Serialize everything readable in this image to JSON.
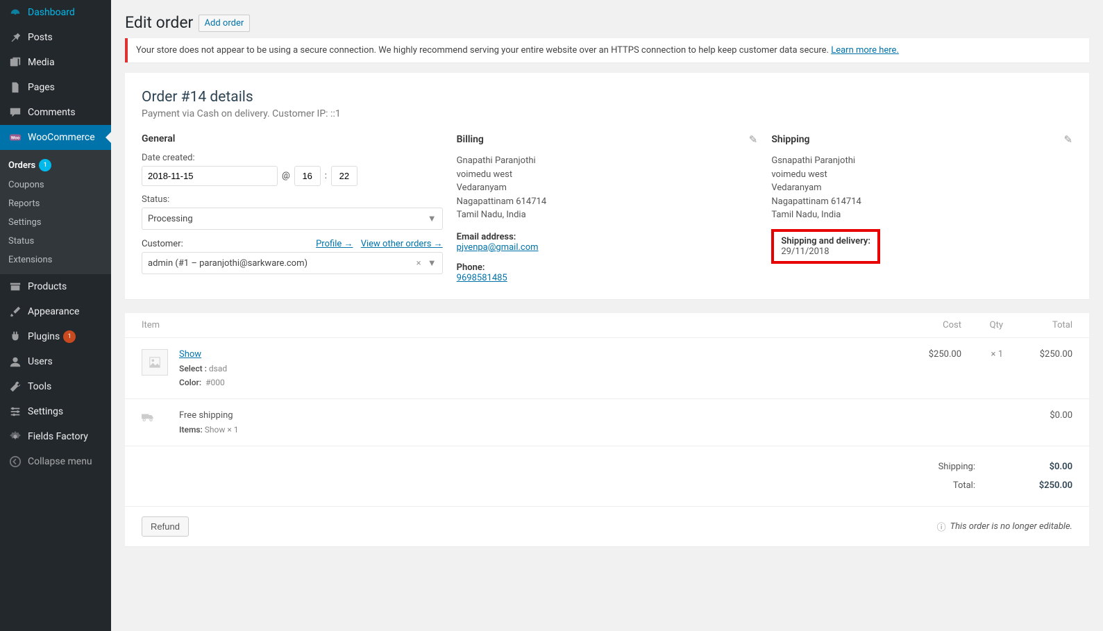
{
  "sidebar": {
    "dashboard": "Dashboard",
    "posts": "Posts",
    "media": "Media",
    "pages": "Pages",
    "comments": "Comments",
    "woocommerce": "WooCommerce",
    "submenu": {
      "orders": "Orders",
      "orders_count": "1",
      "coupons": "Coupons",
      "reports": "Reports",
      "settings": "Settings",
      "status": "Status",
      "extensions": "Extensions"
    },
    "products": "Products",
    "appearance": "Appearance",
    "plugins": "Plugins",
    "plugins_count": "1",
    "users": "Users",
    "tools": "Tools",
    "settings2": "Settings",
    "fields_factory": "Fields Factory",
    "collapse": "Collapse menu"
  },
  "header": {
    "title": "Edit order",
    "add": "Add order"
  },
  "notice": {
    "text": "Your store does not appear to be using a secure connection. We highly recommend serving your entire website over an HTTPS connection to help keep customer data secure. ",
    "link": "Learn more here."
  },
  "order": {
    "title": "Order #14 details",
    "sub": "Payment via Cash on delivery. Customer IP: ::1"
  },
  "general": {
    "heading": "General",
    "date_label": "Date created:",
    "date": "2018-11-15",
    "at": "@",
    "hour": "16",
    "sep": ":",
    "min": "22",
    "status_label": "Status:",
    "status": "Processing",
    "customer_label": "Customer:",
    "profile": "Profile →",
    "view_others": "View other orders →",
    "customer": "admin (#1 – paranjothi@sarkware.com)"
  },
  "billing": {
    "heading": "Billing",
    "name": "Gnapathi Paranjothi",
    "street": "voimedu west",
    "city": "Vedaranyam",
    "district": "Nagapattinam 614714",
    "state": "Tamil Nadu, India",
    "email_label": "Email address:",
    "email": "pjvenpa@gmail.com",
    "phone_label": "Phone:",
    "phone": "9698581485"
  },
  "shipping": {
    "heading": "Shipping",
    "name": "Gsnapathi Paranjothi",
    "street": "voimedu west",
    "city": "Vedaranyam",
    "district": "Nagapattinam 614714",
    "state": "Tamil Nadu, India",
    "delivery_label": "Shipping and delivery:",
    "delivery_date": "29/11/2018"
  },
  "items": {
    "header": {
      "item": "Item",
      "cost": "Cost",
      "qty": "Qty",
      "total": "Total"
    },
    "row": {
      "name": "Show",
      "select_label": "Select :",
      "select_val": "dsad",
      "color_label": "Color:",
      "color_val": "#000",
      "cost": "$250.00",
      "qty": "× 1",
      "total": "$250.00"
    },
    "ship_row": {
      "name": "Free shipping",
      "items_label": "Items:",
      "items_val": "Show × 1",
      "total": "$0.00"
    }
  },
  "totals": {
    "shipping_label": "Shipping:",
    "shipping_val": "$0.00",
    "total_label": "Total:",
    "total_val": "$250.00"
  },
  "footer": {
    "refund": "Refund",
    "note": "This order is no longer editable."
  }
}
